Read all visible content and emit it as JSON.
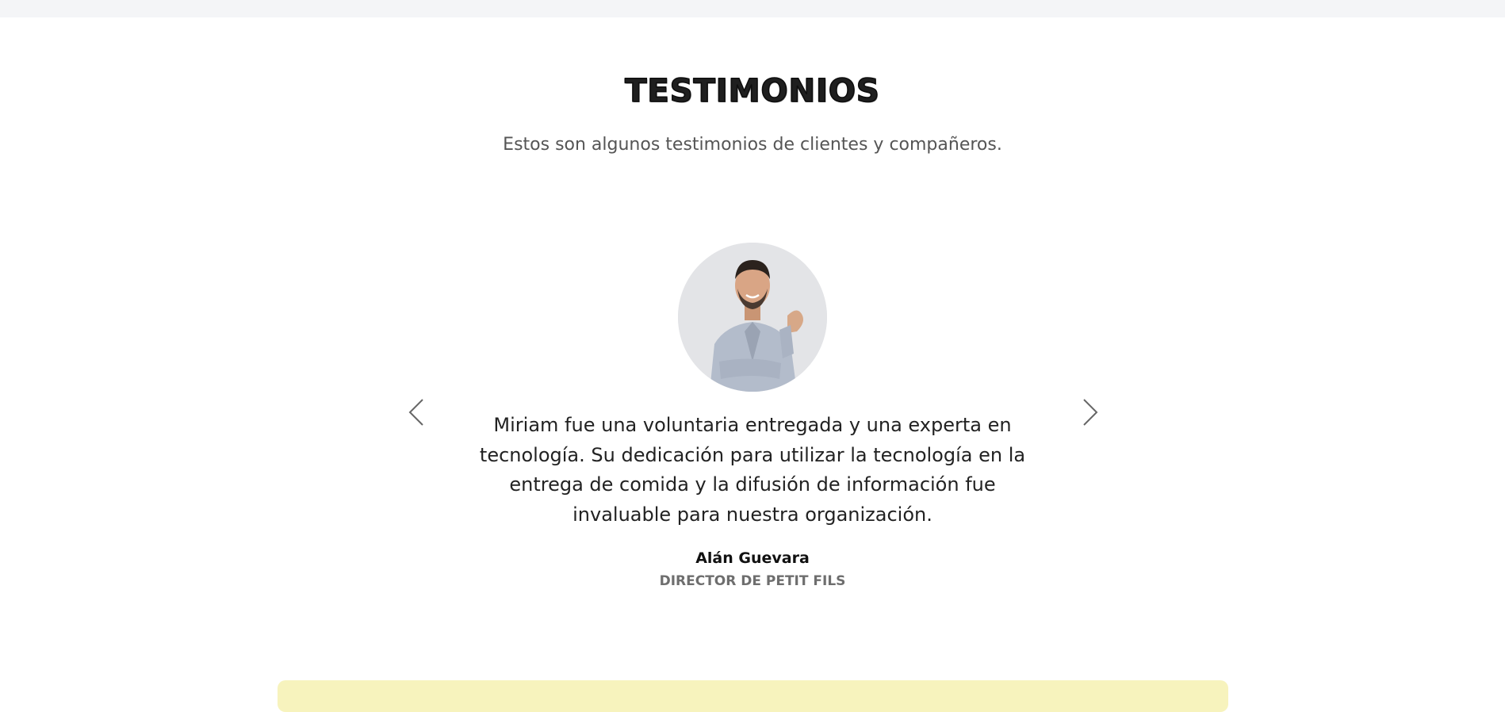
{
  "section": {
    "title": "TESTIMONIOS",
    "subtitle": "Estos son algunos testimonios de clientes y compañeros."
  },
  "testimonial": {
    "quote": "Miriam fue una voluntaria entregada y una experta en tecnología. Su dedicación para utilizar la tecnología en la entrega de comida y la difusión de información fue invaluable para nuestra organización.",
    "author_name": "Alán Guevara",
    "author_role": "DIRECTOR DE PETIT FILS"
  },
  "icons": {
    "prev": "chevron-left-icon",
    "next": "chevron-right-icon"
  },
  "colors": {
    "accent_card": "#f7f3bd",
    "subtitle": "#555555",
    "role": "#6e6e6e"
  }
}
